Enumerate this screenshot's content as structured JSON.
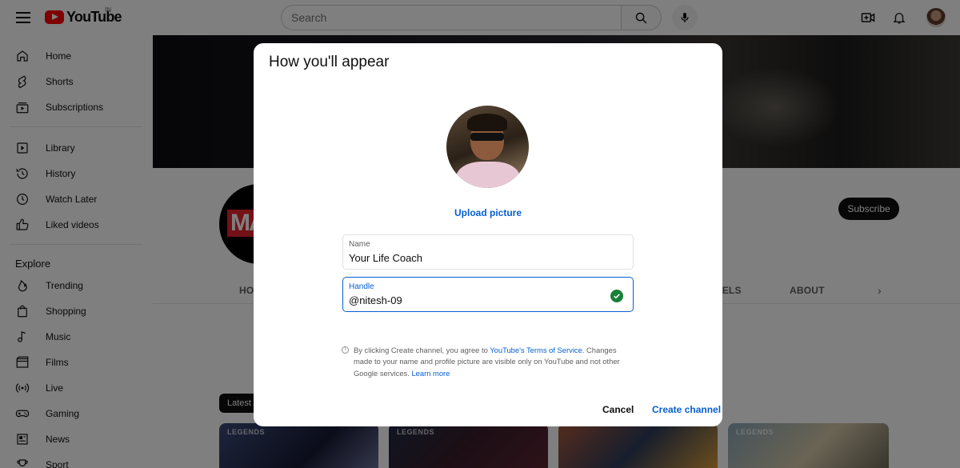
{
  "header": {
    "logo_text": "YouTube",
    "country_code": "IN",
    "search_placeholder": "Search"
  },
  "sidebar": {
    "items_top": [
      {
        "label": "Home",
        "icon": "home-icon"
      },
      {
        "label": "Shorts",
        "icon": "shorts-icon"
      },
      {
        "label": "Subscriptions",
        "icon": "subscriptions-icon"
      }
    ],
    "items_library": [
      {
        "label": "Library",
        "icon": "library-icon"
      },
      {
        "label": "History",
        "icon": "history-icon"
      },
      {
        "label": "Watch Later",
        "icon": "watch-later-icon"
      },
      {
        "label": "Liked videos",
        "icon": "thumbs-up-icon"
      }
    ],
    "explore_heading": "Explore",
    "items_explore": [
      {
        "label": "Trending",
        "icon": "trending-icon"
      },
      {
        "label": "Shopping",
        "icon": "shopping-bag-icon"
      },
      {
        "label": "Music",
        "icon": "music-note-icon"
      },
      {
        "label": "Films",
        "icon": "film-icon"
      },
      {
        "label": "Live",
        "icon": "live-icon"
      },
      {
        "label": "Gaming",
        "icon": "gamepad-icon"
      },
      {
        "label": "News",
        "icon": "news-icon"
      },
      {
        "label": "Sport",
        "icon": "trophy-icon"
      }
    ]
  },
  "channel": {
    "subscribe_label": "Subscribe",
    "avatar_text": "MA",
    "tabs": [
      "HO",
      "NNELS",
      "ABOUT"
    ],
    "latest_chip": "Latest",
    "thumb_labels": [
      "LEGENDS",
      "LEGENDS",
      "",
      "LEGENDS"
    ]
  },
  "dialog": {
    "title": "How you'll appear",
    "upload_label": "Upload picture",
    "name_label": "Name",
    "name_value": "Your Life Coach",
    "handle_label": "Handle",
    "handle_value": "@nitesh-09",
    "disclaimer_prefix": "By clicking Create channel, you agree to ",
    "terms_link": "YouTube's Terms of Service",
    "disclaimer_middle": ". Changes made to your name and profile picture are visible only on YouTube and not other Google services. ",
    "learn_more": "Learn more",
    "cancel_label": "Cancel",
    "create_label": "Create channel"
  },
  "colors": {
    "accent": "#065fd4",
    "brand_red": "#ff0000",
    "success": "#188038"
  }
}
